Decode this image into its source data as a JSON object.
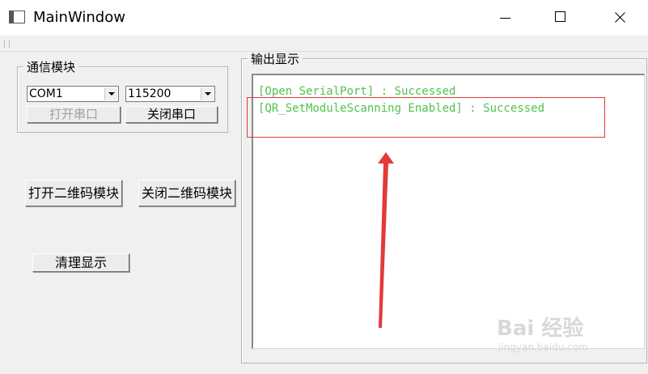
{
  "window": {
    "title": "MainWindow",
    "controls": [
      "minimize",
      "maximize",
      "close"
    ]
  },
  "comm": {
    "title": "通信模块",
    "port": "COM1",
    "baud": "115200",
    "open_port_label": "打开串口",
    "close_port_label": "关闭串口"
  },
  "module": {
    "open_label": "打开二维码模块",
    "close_label": "关闭二维码模块"
  },
  "clear_label": "清理显示",
  "output": {
    "title": "输出显示",
    "lines": [
      "[Open SerialPort] : Successed",
      "[QR_SetModuleScanning Enabled] : Successed"
    ]
  },
  "annotation": {
    "box_color": "#e23a3a",
    "arrow_color": "#e23a3a"
  },
  "watermark": {
    "brand": "Bai 经验",
    "url": "jingyan.baidu.com"
  },
  "colors": {
    "output_text": "#4fc24f"
  }
}
